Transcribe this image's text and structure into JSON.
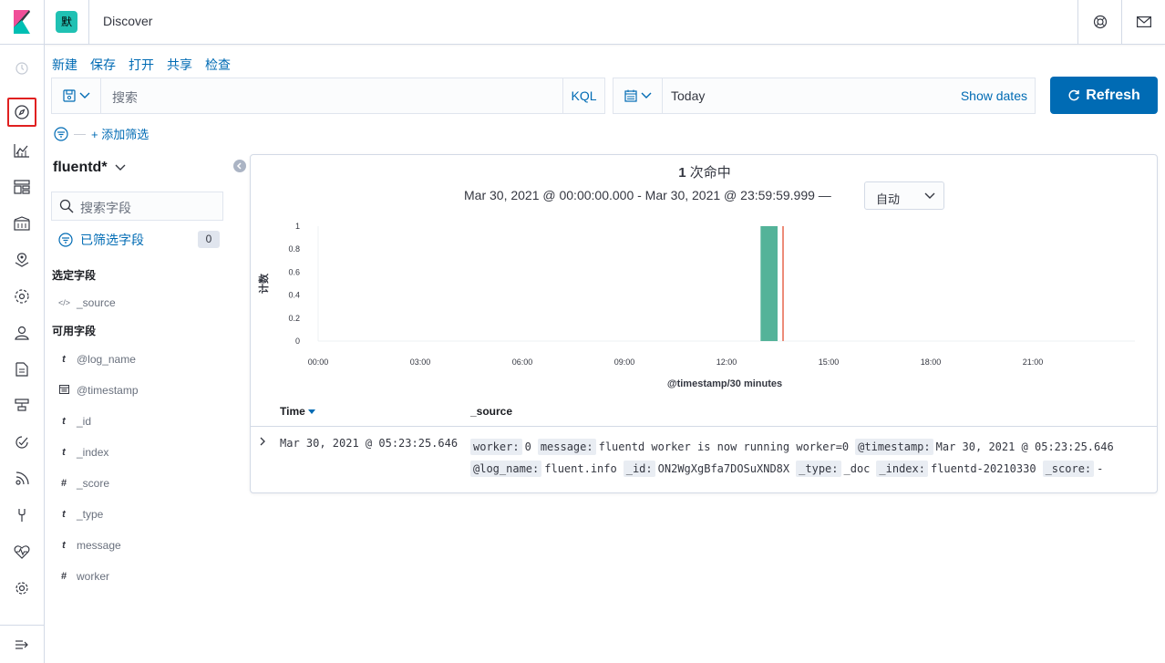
{
  "app": {
    "space_initial": "默",
    "breadcrumb": "Discover"
  },
  "topnav": {
    "menu": [
      "新建",
      "保存",
      "打开",
      "共享",
      "检查"
    ]
  },
  "query": {
    "placeholder": "搜索",
    "language": "KQL"
  },
  "date": {
    "value": "Today",
    "show_dates": "Show dates",
    "refresh_label": "Refresh"
  },
  "filters": {
    "add_label": "+ 添加筛选"
  },
  "sidebar": {
    "index_pattern": "fluentd*",
    "search_placeholder": "搜索字段",
    "filtered_label": "已筛选字段",
    "filtered_count": "0",
    "selected_label": "选定字段",
    "selected_fields": [
      {
        "type": "</>",
        "name": "_source"
      }
    ],
    "available_label": "可用字段",
    "available_fields": [
      {
        "type": "t",
        "name": "@log_name"
      },
      {
        "type": "cal",
        "name": "@timestamp"
      },
      {
        "type": "t",
        "name": "_id"
      },
      {
        "type": "t",
        "name": "_index"
      },
      {
        "type": "#",
        "name": "_score"
      },
      {
        "type": "t",
        "name": "_type"
      },
      {
        "type": "t",
        "name": "message"
      },
      {
        "type": "#",
        "name": "worker"
      }
    ]
  },
  "results": {
    "hits_count": "1",
    "hits_label": "次命中",
    "range": "Mar 30, 2021 @ 00:00:00.000 - Mar 30, 2021 @ 23:59:59.999 —",
    "interval": "自动"
  },
  "chart_data": {
    "type": "bar",
    "xlabel": "@timestamp/30 minutes",
    "ylabel": "计数",
    "ylim": [
      0,
      1
    ],
    "yticks": [
      "1",
      "0.8",
      "0.6",
      "0.4",
      "0.2",
      "0"
    ],
    "xticks": [
      "00:00",
      "03:00",
      "06:00",
      "09:00",
      "12:00",
      "15:00",
      "18:00",
      "21:00"
    ],
    "bars": [
      {
        "x": "13:00",
        "value": 1
      }
    ],
    "now_marker": "13:30",
    "bar_color": "#54b399",
    "marker_color": "#e7664c"
  },
  "table": {
    "col_time": "Time",
    "col_source": "_source",
    "rows": [
      {
        "time": "Mar 30, 2021 @ 05:23:25.646",
        "source": [
          {
            "k": "worker:",
            "v": "0"
          },
          {
            "k": "message:",
            "v": "fluentd worker is now running worker=0"
          },
          {
            "k": "@timestamp:",
            "v": "Mar 30, 2021 @ 05:23:25.646"
          },
          {
            "k": "@log_name:",
            "v": "fluent.info"
          },
          {
            "k": "_id:",
            "v": "ON2WgXgBfa7DOSuXND8X"
          },
          {
            "k": "_type:",
            "v": "_doc"
          },
          {
            "k": "_index:",
            "v": "fluentd-20210330"
          },
          {
            "k": "_score:",
            "v": "-"
          }
        ]
      }
    ]
  }
}
